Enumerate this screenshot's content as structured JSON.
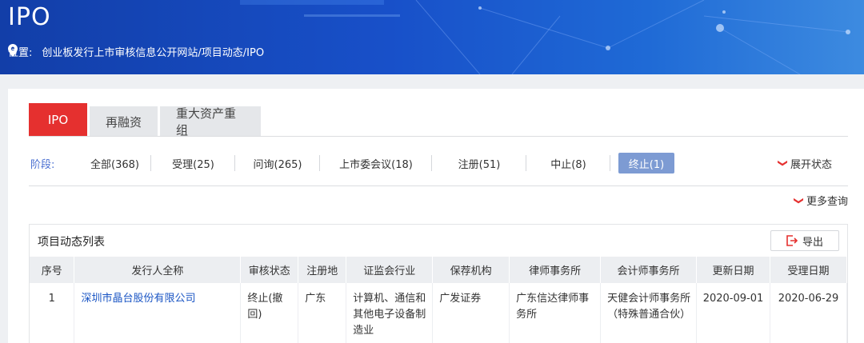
{
  "banner": {
    "title": "IPO",
    "location_label": "位置:",
    "path": "创业板发行上市审核信息公开网站/项目动态/IPO"
  },
  "tabs": [
    {
      "label": "IPO",
      "active": true
    },
    {
      "label": "再融资",
      "active": false
    },
    {
      "label": "重大资产重组",
      "active": false
    }
  ],
  "stages": {
    "label": "阶段:",
    "items": [
      {
        "label": "全部(368)"
      },
      {
        "label": "受理(25)"
      },
      {
        "label": "问询(265)"
      },
      {
        "label": "上市委会议(18)"
      },
      {
        "label": "注册(51)"
      },
      {
        "label": "中止(8)"
      },
      {
        "label": "终止(1)",
        "active": true
      }
    ],
    "expand_label": "展开状态"
  },
  "more_query": "更多查询",
  "list": {
    "title": "项目动态列表",
    "export_label": "导出",
    "headers": [
      "序号",
      "发行人全称",
      "审核状态",
      "注册地",
      "证监会行业",
      "保荐机构",
      "律师事务所",
      "会计师事务所",
      "更新日期",
      "受理日期"
    ],
    "rows": [
      {
        "index": "1",
        "issuer": "深圳市晶台股份有限公司",
        "status": "终止(撤回)",
        "region": "广东",
        "industry": "计算机、通信和其他电子设备制造业",
        "sponsor": "广发证券",
        "law_firm": "广东信达律师事务所",
        "accounting_firm": "天健会计师事务所（特殊普通合伙）",
        "update_date": "2020-09-01",
        "accept_date": "2020-06-29"
      }
    ]
  },
  "colors": {
    "accent": "#e5302f",
    "stage_active": "#7d9bd3",
    "link": "#1a55c4",
    "banner": "#1850c9"
  }
}
